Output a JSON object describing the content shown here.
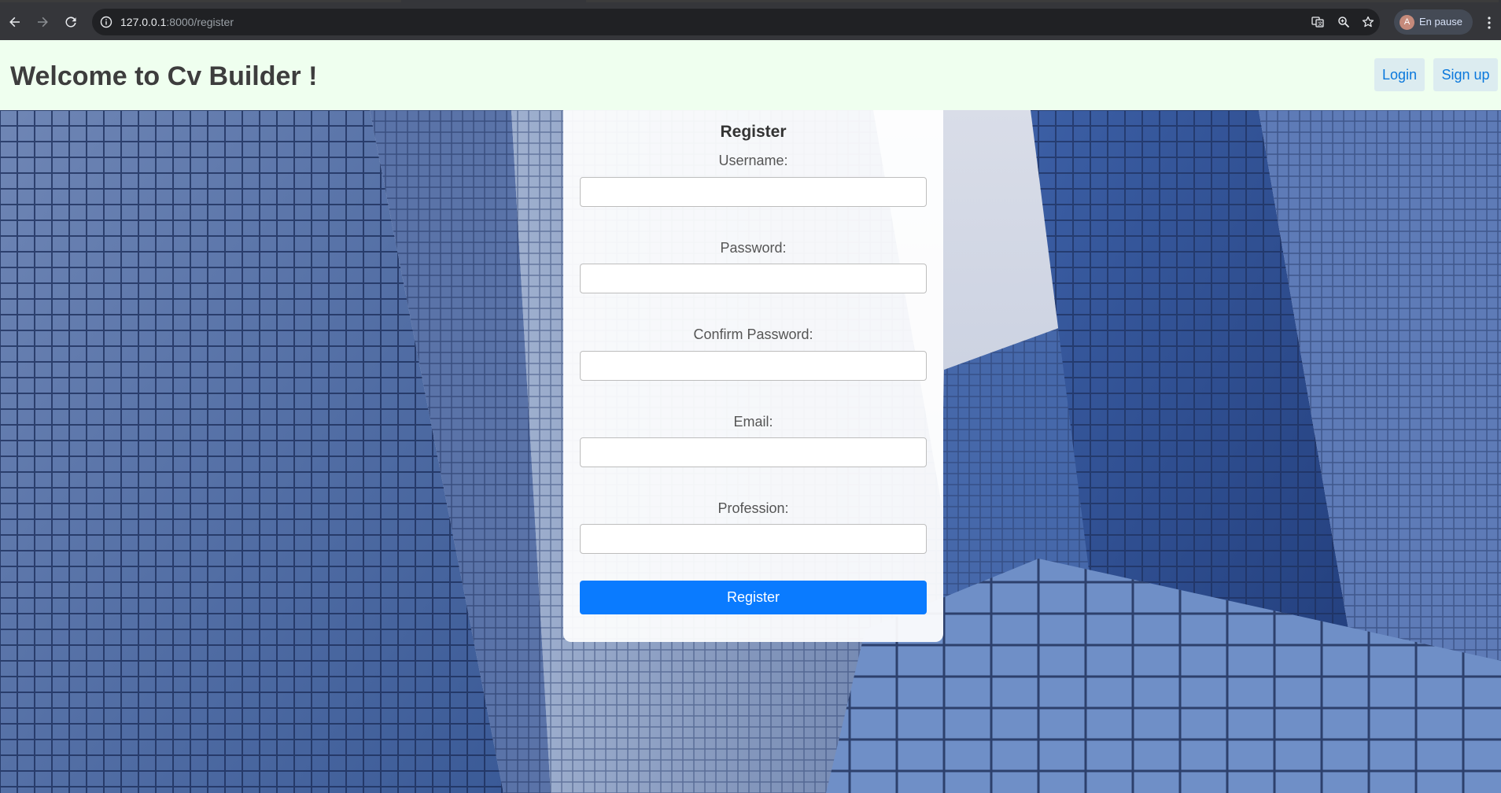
{
  "browser": {
    "url_host": "127.0.0.1",
    "url_rest": ":8000/register",
    "profile_initial": "A",
    "profile_status": "En pause"
  },
  "header": {
    "title": "Welcome to Cv Builder !",
    "login_label": "Login",
    "signup_label": "Sign up"
  },
  "form": {
    "title": "Register",
    "fields": [
      {
        "label": "Username:",
        "value": ""
      },
      {
        "label": "Password:",
        "value": ""
      },
      {
        "label": "Confirm Password:",
        "value": ""
      },
      {
        "label": "Email:",
        "value": ""
      },
      {
        "label": "Profession:",
        "value": ""
      }
    ],
    "submit_label": "Register"
  },
  "colors": {
    "header_bg": "#efffef",
    "header_button_bg": "#dcecf0",
    "link_blue": "#0a78dc",
    "primary_button": "#0a7bff"
  }
}
